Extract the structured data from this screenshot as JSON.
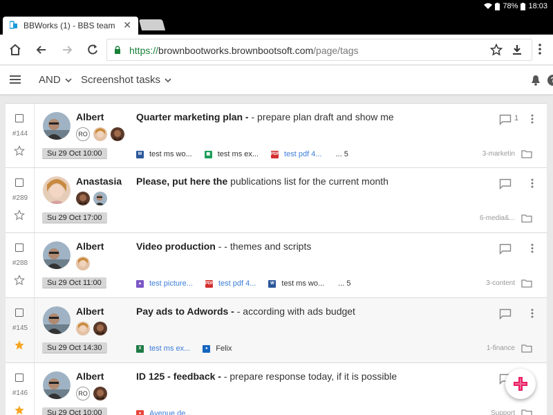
{
  "status_bar": {
    "battery": "78%",
    "time": "18:03"
  },
  "browser": {
    "tab_title": "BBWorks (1) - BBS team",
    "url_scheme": "https://",
    "url_host": "brownbootworks.brownbootsoft.com",
    "url_path": "/page/tags"
  },
  "header": {
    "filter_label": "AND",
    "view_label": "Screenshot tasks"
  },
  "tasks": [
    {
      "id": "#144",
      "owner": "Albert",
      "starred": false,
      "date": "Su 29 Oct 10:00",
      "title_bold": "Quarter marketing plan - ",
      "title_rest": "- prepare plan draft and show me",
      "assignee_initials": "RO",
      "attachments": [
        {
          "type": "word",
          "label": "test ms wo..."
        },
        {
          "type": "sheet",
          "label": "test ms ex..."
        },
        {
          "type": "pdf",
          "label": "test pdf 4..."
        }
      ],
      "more_label": "... 5",
      "comment_count": "1",
      "project": "3-marketin"
    },
    {
      "id": "#289",
      "owner": "Anastasia",
      "starred": false,
      "date": "Su 29 Oct 17:00",
      "title_bold": "Please, put here the",
      "title_rest": " publications list for the current month",
      "attachments": [],
      "project": "6-media&..."
    },
    {
      "id": "#288",
      "owner": "Albert",
      "starred": false,
      "date": "Su 29 Oct 11:00",
      "title_bold": "Video production ",
      "title_rest": " - - themes and scripts",
      "attachments": [
        {
          "type": "image",
          "label": "test picture..."
        },
        {
          "type": "pdf",
          "label": "test pdf 4..."
        },
        {
          "type": "word",
          "label": "test ms wo..."
        }
      ],
      "more_label": "... 5",
      "project": "3-content"
    },
    {
      "id": "#145",
      "owner": "Albert",
      "starred": true,
      "date": "Su 29 Oct 14:30",
      "title_bold": "Pay ads to Adwords - ",
      "title_rest": "- according with ads budget",
      "attachments": [
        {
          "type": "excel",
          "label": "test ms ex..."
        },
        {
          "type": "contact",
          "label": "Felix"
        }
      ],
      "project": "1-finance"
    },
    {
      "id": "#146",
      "owner": "Albert",
      "starred": true,
      "date": "Su 29 Oct 10:00",
      "title_bold": "ID 125 - feedback - ",
      "title_rest": "- prepare response today, if it is possible",
      "assignee_initials": "RO",
      "attachments": [
        {
          "type": "map",
          "label": "Avenue de..."
        }
      ],
      "project": "Support"
    }
  ],
  "colors": {
    "accent_pink": "#e91e63",
    "star_gold": "#f5a623",
    "link_blue": "#3b7dd8"
  }
}
